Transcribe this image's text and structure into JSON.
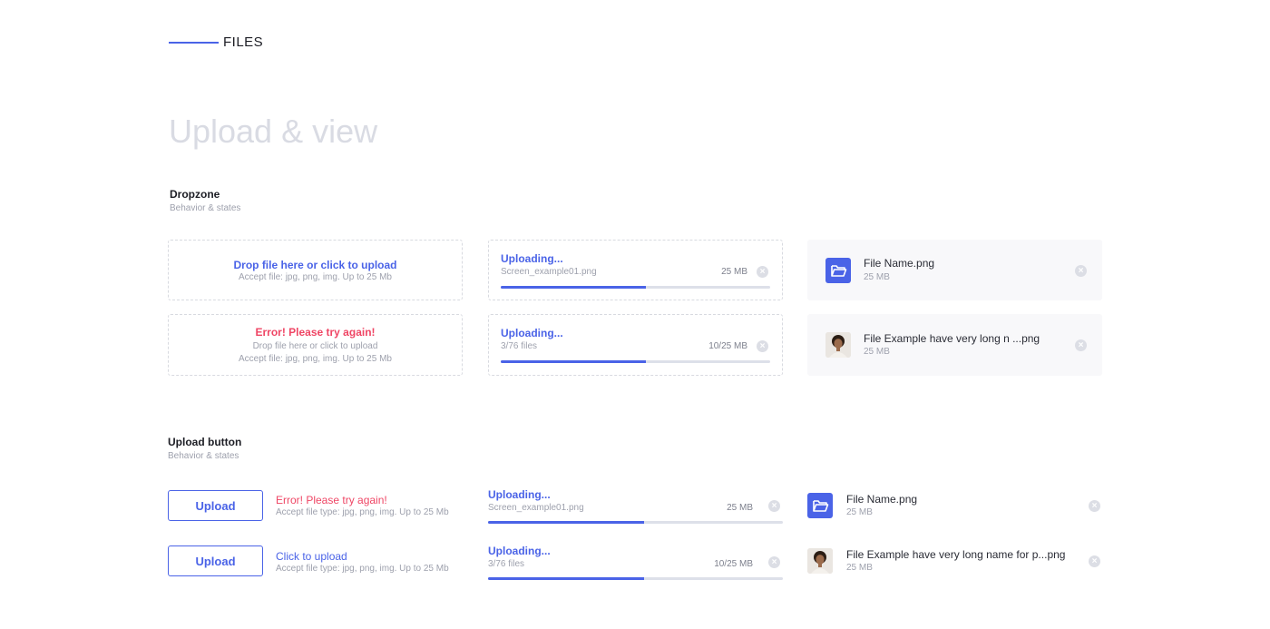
{
  "header": {
    "title": "FILES"
  },
  "page_title": "Upload & view",
  "dropzone_section": {
    "title": "Dropzone",
    "subtitle": "Behavior & states",
    "default": {
      "main": "Drop file here or click to upload",
      "hint": "Accept file: jpg, png, img. Up to 25 Mb"
    },
    "error": {
      "main": "Error! Please try again!",
      "line2": "Drop file here or click to upload",
      "hint": "Accept file: jpg, png, img. Up to 25 Mb"
    },
    "uploading_single": {
      "title": "Uploading...",
      "name": "Screen_example01.png",
      "size": "25 MB",
      "progress": 0.54
    },
    "uploading_multi": {
      "title": "Uploading...",
      "name": "3/76 files",
      "size": "10/25 MB",
      "progress": 0.54
    },
    "file_folder": {
      "name": "File Name.png",
      "size": "25 MB"
    },
    "file_image": {
      "name": "File Example have very long n ...png",
      "size": "25 MB"
    }
  },
  "upload_button_section": {
    "title": "Upload button",
    "subtitle": "Behavior & states",
    "row1": {
      "button": "Upload",
      "status": "Error! Please try again!",
      "hint": "Accept file type: jpg, png, img. Up to 25 Mb"
    },
    "row2": {
      "button": "Upload",
      "status": "Click to upload",
      "hint": "Accept file type: jpg, png, img. Up to 25 Mb"
    },
    "uploading_single": {
      "title": "Uploading...",
      "name": "Screen_example01.png",
      "size": "25 MB",
      "progress": 0.53
    },
    "uploading_multi": {
      "title": "Uploading...",
      "name": "3/76 files",
      "size": "10/25 MB",
      "progress": 0.53
    },
    "file_folder": {
      "name": "File Name.png",
      "size": "25 MB"
    },
    "file_image": {
      "name": "File Example have very long name for p...png",
      "size": "25 MB"
    }
  },
  "icons": {
    "remove": "close-circle-icon",
    "folder": "folder-open-icon",
    "avatar": "avatar-photo"
  },
  "colors": {
    "accent": "#4a63e7",
    "error": "#ef4665",
    "muted": "#9ea1ad",
    "title_light": "#d9dbe3"
  }
}
